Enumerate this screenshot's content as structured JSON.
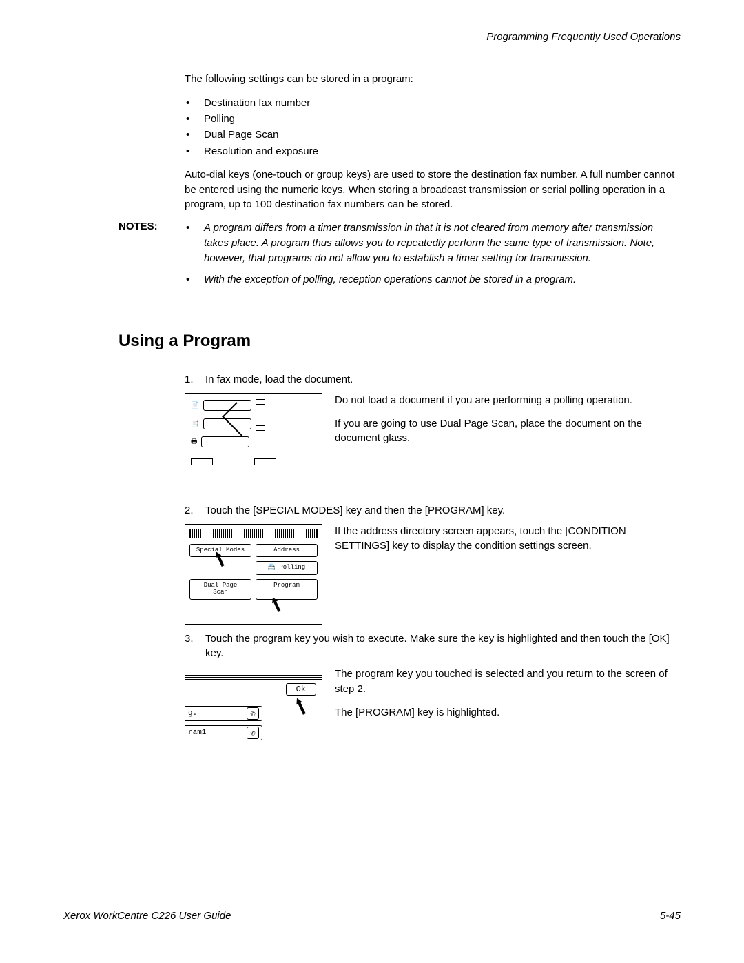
{
  "header": {
    "section_title": "Programming Frequently Used Operations"
  },
  "intro": "The following settings can be stored in a program:",
  "settings_list": [
    "Destination fax number",
    "Polling",
    "Dual Page Scan",
    "Resolution and exposure"
  ],
  "auto_dial_para": "Auto-dial keys (one-touch or group keys) are used to store the destination fax number. A full number cannot be entered using the numeric keys. When storing a broadcast transmission or serial polling operation in a program, up to 100 destination fax numbers can be stored.",
  "notes_label": "NOTES:",
  "notes": [
    "A program differs from a timer transmission in that it is not cleared from memory after transmission takes place. A program thus allows you to repeatedly perform the same type of transmission. Note, however, that programs do not allow you to establish a timer setting for transmission.",
    "With the exception of polling, reception operations cannot be stored in a program."
  ],
  "section_heading": "Using a Program",
  "steps": {
    "s1": {
      "num": "1.",
      "text": "In fax mode, load the document.",
      "desc": [
        "Do not load a document if you are performing a polling operation.",
        "If you are going to use Dual Page Scan, place the document on the document glass."
      ]
    },
    "s2": {
      "num": "2.",
      "text": "Touch the [SPECIAL MODES] key and then the [PROGRAM] key.",
      "desc": [
        "If the address directory screen appears, touch the [CONDITION SETTINGS] key to display the condition settings screen."
      ],
      "fig": {
        "special_modes": "Special Modes",
        "address": "Address",
        "polling": "Polling",
        "dual_page_scan": "Dual Page\nScan",
        "program": "Program"
      }
    },
    "s3": {
      "num": "3.",
      "text": "Touch the program key you wish to execute. Make sure the key is highlighted and then touch the [OK] key.",
      "desc": [
        "The program key you touched is selected and you return to the screen of step 2.",
        "The [PROGRAM] key is highlighted."
      ],
      "fig": {
        "ok": "Ok",
        "row1": "g.",
        "row2": "ram1"
      }
    }
  },
  "footer": {
    "guide": "Xerox WorkCentre C226 User Guide",
    "page": "5-45"
  }
}
